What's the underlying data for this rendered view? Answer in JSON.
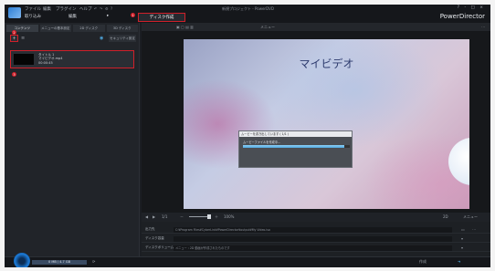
{
  "titlebar": {
    "menu": [
      "ファイル",
      "編集",
      "プラグイン",
      "ヘルプ"
    ],
    "window_title": "新規プロジェクト - PowerDVD",
    "brand": "PowerDirector",
    "window_controls": "? - □ ×"
  },
  "mode_tabs": [
    "取り込み",
    "編集",
    "ディスク作成"
  ],
  "active_tab": "ディスク作成",
  "badges": [
    "1",
    "2",
    "3"
  ],
  "left_panel": {
    "tabs": [
      "コンテンツ",
      "メニューの基本設定",
      "2D ディスク",
      "3D ディスク"
    ],
    "security_button": "セキュリティ設定",
    "item": {
      "title": "タイトル 1",
      "line2": "マイビデオ.mp4",
      "line3": "00:00:45"
    }
  },
  "preview": {
    "video_title": "マイビデオ",
    "top_label": "メニュー",
    "dialog": {
      "title": "ムービーを書き出しています ( 1/1 )",
      "message": "ムービーファイルを作成中...",
      "progress": 0.95
    }
  },
  "playbar": {
    "page": "1/1",
    "zoom": "100%",
    "mode": "2D",
    "right": "メニュー"
  },
  "properties": [
    {
      "label": "出力先",
      "value": "C:¥Program Files¥CyberLink¥PowerDirector¥output¥My Video.iso"
    },
    {
      "label": "ディスク容量",
      "value": ""
    },
    {
      "label": "ディスクボリューム",
      "value": "メニュー : 2D 動画が作成されたものです"
    }
  ],
  "statusbar": {
    "capacity": "0 MB / 4.7 GB",
    "ready": "作成"
  },
  "colors": {
    "highlight": "#d0202a",
    "progress": "#4fa9e0"
  }
}
